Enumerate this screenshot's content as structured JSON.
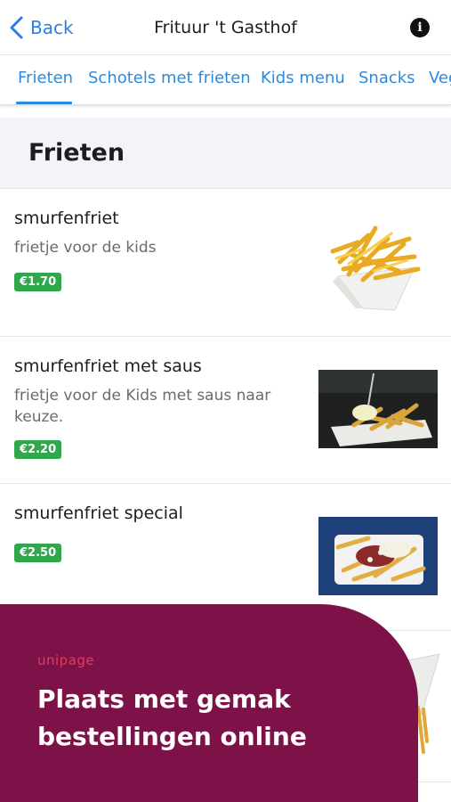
{
  "nav": {
    "back_label": "Back",
    "title": "Frituur 't Gasthof",
    "info_icon": "info-icon"
  },
  "tabs": [
    {
      "label": "Frieten",
      "active": true
    },
    {
      "label": "Schotels met frieten",
      "active": false
    },
    {
      "label": "Kids menu",
      "active": false
    },
    {
      "label": "Snacks",
      "active": false
    },
    {
      "label": "Veg",
      "active": false
    }
  ],
  "section": {
    "title": "Frieten"
  },
  "items": [
    {
      "name": "smurfenfriet",
      "description": "frietje voor de kids",
      "price": "€1.70",
      "image": "fries-tray-image"
    },
    {
      "name": "smurfenfriet met saus",
      "description": "frietje voor de Kids met saus naar keuze.",
      "price": "€2.20",
      "image": "fries-with-sauce-image"
    },
    {
      "name": "smurfenfriet special",
      "description": "",
      "price": "€2.50",
      "image": "fries-special-image"
    }
  ],
  "promo": {
    "logo": "unipage",
    "text": "Plaats met gemak bestellingen online"
  },
  "colors": {
    "accent": "#2a8be0",
    "price_badge": "#2ea84b",
    "promo_bg": "#7d1249",
    "promo_logo": "#e23a5c"
  }
}
